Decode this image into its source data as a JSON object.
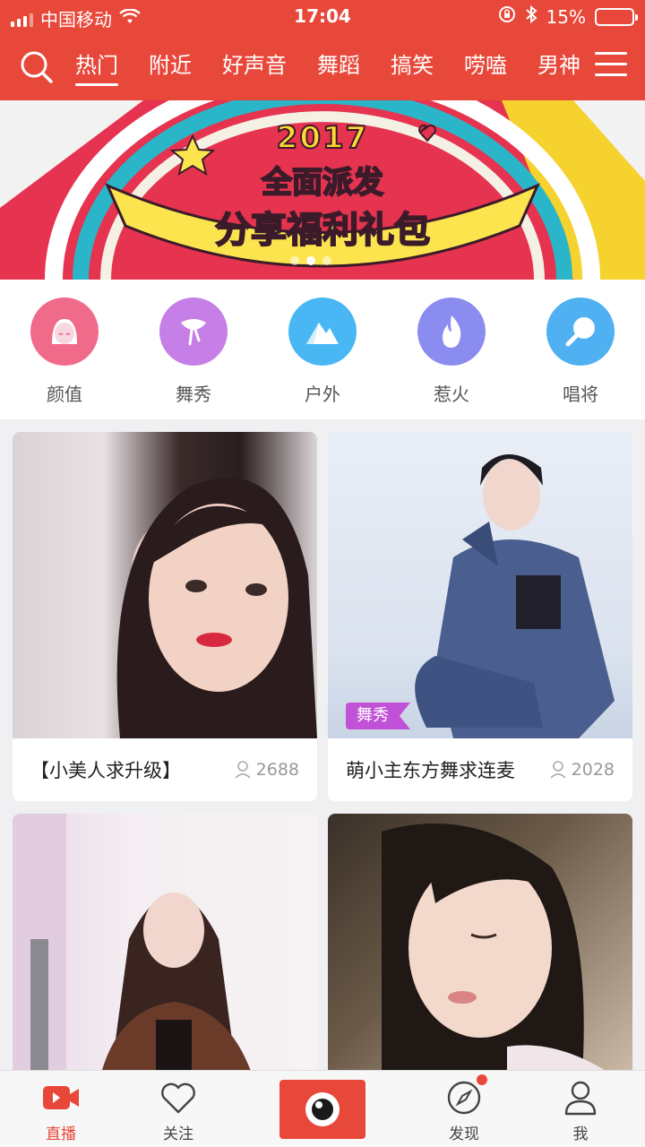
{
  "status": {
    "carrier": "中国移动",
    "time": "17:04",
    "battery": "15%"
  },
  "nav": {
    "tabs": [
      "热门",
      "附近",
      "好声音",
      "舞蹈",
      "搞笑",
      "唠嗑",
      "男神"
    ],
    "active_tab": "热门"
  },
  "banner": {
    "year": "2017",
    "line2": "全面派发",
    "line3": "分享福利礼包"
  },
  "categories": [
    {
      "label": "颜值",
      "icon": "face-icon",
      "color": "#f06a8a"
    },
    {
      "label": "舞秀",
      "icon": "dance-icon",
      "color": "#c57fe6"
    },
    {
      "label": "户外",
      "icon": "mountain-icon",
      "color": "#49b7f3"
    },
    {
      "label": "惹火",
      "icon": "flame-icon",
      "color": "#8b8cf0"
    },
    {
      "label": "唱将",
      "icon": "microphone-icon",
      "color": "#4fb0f2"
    }
  ],
  "feed": [
    {
      "title": "【小美人求升级】",
      "viewers": "2688",
      "tag": ""
    },
    {
      "title": "萌小主东方舞求连麦",
      "viewers": "2028",
      "tag": "舞秀"
    },
    {
      "title": "",
      "viewers": "",
      "tag": ""
    },
    {
      "title": "",
      "viewers": "",
      "tag": ""
    }
  ],
  "tabbar": {
    "items": [
      {
        "label": "直播",
        "icon": "live-video-icon"
      },
      {
        "label": "关注",
        "icon": "heart-icon"
      },
      {
        "label": "",
        "icon": "camera-eye-icon"
      },
      {
        "label": "发现",
        "icon": "compass-icon"
      },
      {
        "label": "我",
        "icon": "user-icon"
      }
    ],
    "active": "直播"
  },
  "colors": {
    "brand": "#e8483a",
    "tag": "#c151d6"
  }
}
